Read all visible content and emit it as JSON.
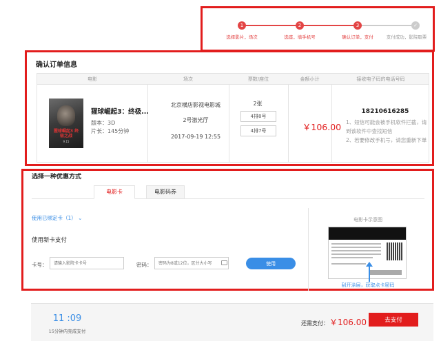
{
  "steps": [
    {
      "num": "1",
      "label": "选择影片，场次"
    },
    {
      "num": "2",
      "label": "选座，填手机号"
    },
    {
      "num": "3",
      "label": "确认订单，支付"
    },
    {
      "num": "✓",
      "label": "支付成功，影院取票"
    }
  ],
  "order": {
    "title": "确认订单信息",
    "headers": [
      "电影",
      "场次",
      "票数/座位",
      "金额小计",
      "接收电子码的电话号码"
    ],
    "movie": {
      "poster_title": "猩球崛起3 终极之战",
      "poster_date": "9.15",
      "name": "猩球崛起3：终极...",
      "version": "版本：3D",
      "duration": "片长：145分钟"
    },
    "session": {
      "cinema": "北京横店影视电影城",
      "hall": "2号激光厅",
      "time": "2017-09-19 12:55"
    },
    "tickets": {
      "count": "2张",
      "seats": [
        "4排8号",
        "4排7号"
      ]
    },
    "subtotal": "￥106.00",
    "phone": "18210616285",
    "notes": [
      "1、短信可能会被手机软件拦截，请到该软件中查找短信",
      "2、若要修改手机号，请您重新下单"
    ]
  },
  "discount": {
    "title": "选择一种优惠方式",
    "tabs": [
      "电影卡",
      "电影码券"
    ],
    "bound_cards": "使用已绑定卡（1）",
    "new_card": "使用新卡支付",
    "card_label": "卡号：",
    "card_placeholder": "请输入影院卡卡号",
    "pw_label": "密码：",
    "pw_placeholder": "密码为8或12位，区分大小写",
    "use_button": "使用",
    "sample_title": "电影卡示意图",
    "scratch_tip": "刮开涂层，获取点卡密码"
  },
  "footer": {
    "timer": "11 :09",
    "timer_note": "15分钟内完成支付",
    "pay_label": "还需支付：",
    "pay_amount": "￥106.00",
    "pay_button": "去支付"
  },
  "colors": {
    "accent": "#e21d1d",
    "link": "#3a8ee6"
  }
}
